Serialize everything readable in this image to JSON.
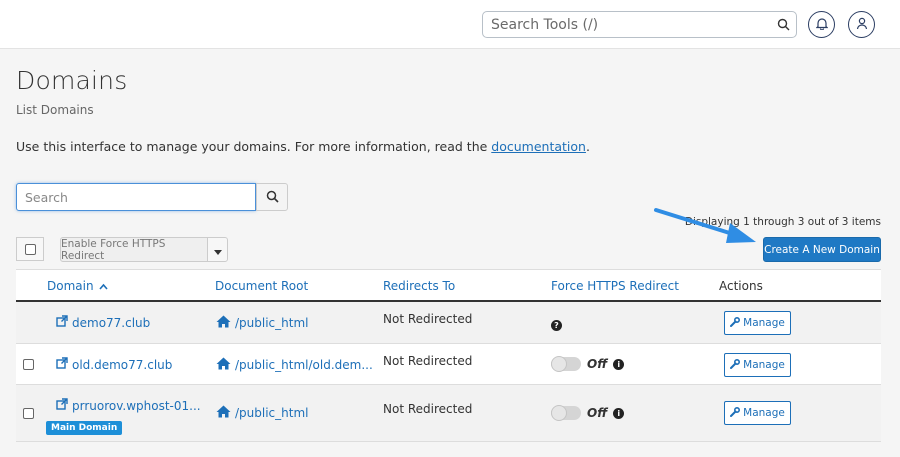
{
  "topbar": {
    "search_placeholder": "Search Tools (/)",
    "icons": [
      "search-icon",
      "bell-icon",
      "user-icon"
    ]
  },
  "page": {
    "title": "Domains",
    "subtitle": "List Domains",
    "intro_text": "Use this interface to manage your domains. For more information, read the ",
    "intro_link": "documentation",
    "intro_end": "."
  },
  "search": {
    "placeholder": "Search"
  },
  "toolbar": {
    "displaying": "Displaying 1 through 3 out of 3 items",
    "force_https_label": "Enable Force HTTPS Redirect",
    "create_label": "Create A New Domain"
  },
  "table": {
    "headers": {
      "domain": "Domain",
      "docroot": "Document Root",
      "redirects": "Redirects To",
      "force": "Force HTTPS Redirect",
      "actions": "Actions"
    },
    "rows": [
      {
        "domain": "demo77.club",
        "docroot": "/public_html",
        "redirects": "Not Redirected",
        "force": "",
        "action": "Manage",
        "badge": ""
      },
      {
        "domain": "old.demo77.club",
        "docroot": "/public_html/old.dem...",
        "redirects": "Not Redirected",
        "force": "Off",
        "action": "Manage",
        "badge": ""
      },
      {
        "domain": "prruorov.wphost-01...",
        "docroot": "/public_html",
        "redirects": "Not Redirected",
        "force": "Off",
        "action": "Manage",
        "badge": "Main Domain"
      }
    ]
  },
  "colors": {
    "accent": "#1d6fb8",
    "primary_button": "#1f79c4",
    "badge": "#1d8fd8",
    "arrow": "#2f8de4"
  }
}
